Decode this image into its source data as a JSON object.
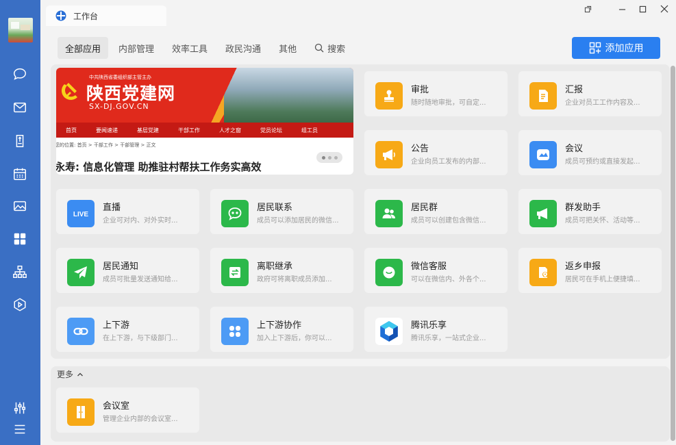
{
  "window": {
    "tab_title": "工作台"
  },
  "categories": [
    {
      "label": "全部应用"
    },
    {
      "label": "内部管理"
    },
    {
      "label": "效率工具"
    },
    {
      "label": "政民沟通"
    },
    {
      "label": "其他"
    },
    {
      "label": "搜索"
    }
  ],
  "add_app_label": "添加应用",
  "banner": {
    "org_line": "中共陕西省委组织部主管主办",
    "site_name": "陕西党建网",
    "site_url": "SX-DJ.GOV.CN",
    "nav": [
      "首页",
      "要闻速递",
      "基层党建",
      "干部工作",
      "人才之窗",
      "党员论坛",
      "组工员"
    ],
    "breadcrumb": "您的位置: 首页 > 干部工作 > 干部管理 > 正文",
    "headline": "永寿: 信息化管理 助推驻村帮扶工作务实高效"
  },
  "apps": [
    {
      "name": "审批",
      "desc": "随时随地审批，可自定...",
      "icon": "stamp-icon",
      "color": "#f7a916"
    },
    {
      "name": "汇报",
      "desc": "企业对员工工作内容及...",
      "icon": "report-icon",
      "color": "#f7a916"
    },
    {
      "name": "公告",
      "desc": "企业向员工发布的内部...",
      "icon": "megaphone-icon",
      "color": "#f7a916"
    },
    {
      "name": "会议",
      "desc": "成员可预约或直接发起...",
      "icon": "meeting-icon",
      "color": "#3b8cf2"
    },
    {
      "name": "直播",
      "desc": "企业可对内、对外实时...",
      "icon": "live-icon",
      "color": "#3b8cf2"
    },
    {
      "name": "居民联系",
      "desc": "成员可以添加居民的微信...",
      "icon": "chat-bubble-icon",
      "color": "#2cb84a"
    },
    {
      "name": "居民群",
      "desc": "成员可以创建包含微信...",
      "icon": "group-icon",
      "color": "#2cb84a"
    },
    {
      "name": "群发助手",
      "desc": "成员可把关怀、活动等...",
      "icon": "broadcast-icon",
      "color": "#2cb84a"
    },
    {
      "name": "居民通知",
      "desc": "成员可批量发送通知给...",
      "icon": "paper-plane-icon",
      "color": "#2cb84a"
    },
    {
      "name": "离职继承",
      "desc": "政府可将离职成员添加...",
      "icon": "transfer-icon",
      "color": "#2cb84a"
    },
    {
      "name": "微信客服",
      "desc": "可以在微信内、外各个...",
      "icon": "service-icon",
      "color": "#2cb84a"
    },
    {
      "name": "返乡申报",
      "desc": "居民可在手机上便捷填...",
      "icon": "location-doc-icon",
      "color": "#f7a916"
    },
    {
      "name": "上下游",
      "desc": "在上下游，与下级部门...",
      "icon": "link-icon",
      "color": "#4d9bf5"
    },
    {
      "name": "上下游协作",
      "desc": "加入上下游后，你可以...",
      "icon": "grid-icon",
      "color": "#4d9bf5"
    },
    {
      "name": "腾讯乐享",
      "desc": "腾讯乐享，一站式企业...",
      "icon": "lexiang-icon",
      "color": "#ffffff"
    }
  ],
  "more": {
    "label": "更多",
    "apps": [
      {
        "name": "会议室",
        "desc": "管理企业内部的会议室...",
        "icon": "door-icon",
        "color": "#f7a916"
      }
    ]
  }
}
